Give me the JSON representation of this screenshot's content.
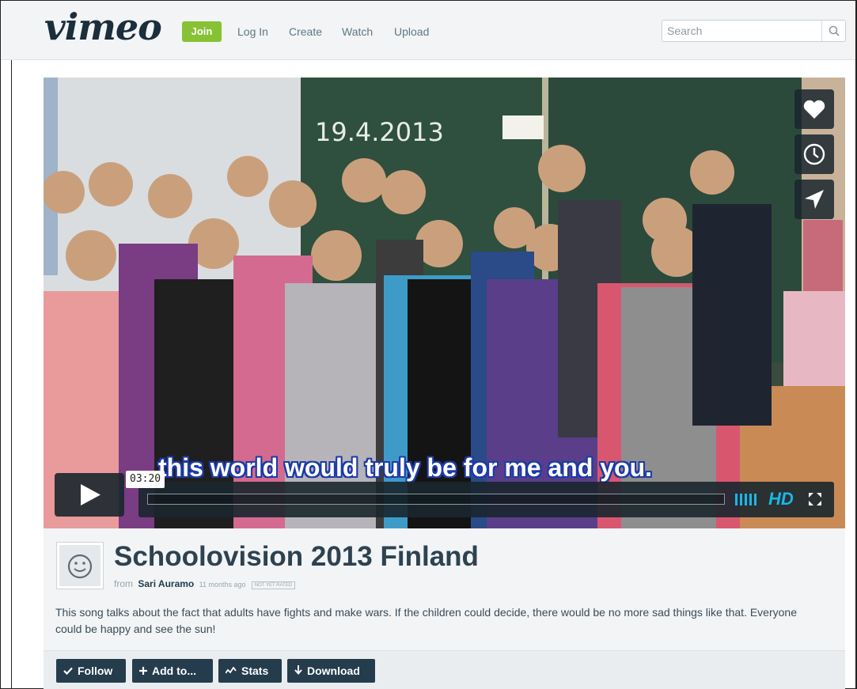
{
  "header": {
    "logo": "vimeo",
    "join_label": "Join",
    "nav": [
      {
        "label": "Log In"
      },
      {
        "label": "Create"
      },
      {
        "label": "Watch"
      },
      {
        "label": "Upload"
      }
    ],
    "search_placeholder": "Search",
    "icons": {
      "search": "magnifier-icon"
    }
  },
  "player": {
    "subtitle": "this world would truly be for me and you.",
    "time_tooltip": "03:20",
    "hd_label": "HD",
    "side_buttons": [
      "heart-icon",
      "clock-icon",
      "send-icon"
    ],
    "accent_color": "#1ab7ea"
  },
  "video_info": {
    "title": "Schoolovision 2013 Finland",
    "from_label": "from",
    "author": "Sari Auramo",
    "uploaded": "11 months ago",
    "rating_badge": "NOT YET RATED",
    "description": "This song talks about the fact that adults have fights and make wars. If the children could decide, there would be no more sad things like that. Everyone could be happy and see the sun!"
  },
  "actions": [
    {
      "label": "Follow",
      "icon": "check-icon"
    },
    {
      "label": "Add to...",
      "icon": "plus-icon"
    },
    {
      "label": "Stats",
      "icon": "stats-icon"
    },
    {
      "label": "Download",
      "icon": "download-arrow-icon"
    }
  ],
  "chalkboard_text": "19.4.2013"
}
